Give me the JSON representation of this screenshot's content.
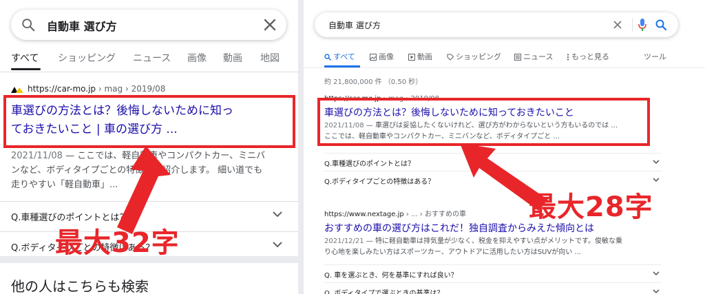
{
  "mobile": {
    "search": {
      "query": "自動車 選び方"
    },
    "tabs": [
      "すべて",
      "ショッピング",
      "ニュース",
      "画像",
      "動画",
      "地図"
    ],
    "result": {
      "cite_domain": "https://car-mo.jp",
      "cite_path": " › mag › 2019/08",
      "title_line1": "車選びの方法とは？後悔しないために知っ",
      "title_line2": "ておきたいこと | 車の選び方 ...",
      "date": "2021/11/08",
      "snippet_line1": " — ここでは、軽自動車やコンパクトカー、ミニバ",
      "snippet_line2": "ンなど、ボディタイプごとの特徴をご紹介します。 細い道でも",
      "snippet_line3": "走りやすい「軽自動車」..."
    },
    "faq": [
      "Q.車種選びのポイントとは？",
      "Q.ボディタイプごとの特徴はある？"
    ],
    "bottom_heading": "他の人はこちらも検索"
  },
  "desktop": {
    "search": {
      "query": "自動車 選び方"
    },
    "tabs": [
      "すべて",
      "画像",
      "動画",
      "ショッピング",
      "ニュース",
      "もっと見る",
      "ツール"
    ],
    "stats": "約 21,800,000 件 （0.50 秒）",
    "result1": {
      "cite_domain": "https://car-mo.jp",
      "cite_path": " › mag › 2019/08",
      "title": "車選びの方法とは？後悔しないために知っておきたいこと",
      "date": "2021/11/08",
      "snippet_line1": " — 車選びは妥協したくないけれど、選び方がわからないという方もいるのでは ...",
      "snippet_line2": "ここでは、軽自動車やコンパクトカー、ミニバンなど、ボディタイプごと ..."
    },
    "faq1": [
      "Q.車種選びのポイントとは？",
      "Q.ボディタイプごとの特徴はある？"
    ],
    "result2": {
      "cite_domain": "https://www.nextage.jp",
      "cite_path": " › ... › おすすめの車",
      "title": "おすすめの車の選び方はこれだ！独自調査からみえた傾向とは",
      "date": "2021/12/21",
      "snippet_line1": " — 特に軽自動車は排気量が少なく、税金を抑えやすい点がメリットです。俊敏な乗",
      "snippet_line2": "り心地を楽しみたい方はスポーツカー、アウトドアに活用したい方はSUVが向い ..."
    },
    "faq2": [
      "Q. 車を選ぶとき、何を基準にすれば良い？",
      "Q. ボディタイプで選ぶときの基準は？"
    ]
  },
  "annotations": {
    "left_label": "最大32字",
    "right_label": "最大28字",
    "color": "#e8262a"
  },
  "colors": {
    "link": "#1a0dab",
    "accent": "#1a73e8",
    "text": "#202124",
    "snippet": "#4d5156"
  }
}
